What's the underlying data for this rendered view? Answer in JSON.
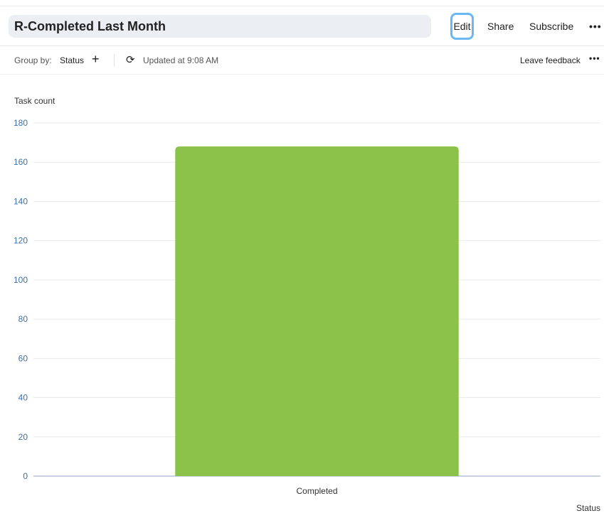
{
  "header": {
    "title": "R-Completed Last Month",
    "edit": "Edit",
    "share": "Share",
    "subscribe": "Subscribe",
    "more": "•••"
  },
  "toolbar": {
    "group_by_label": "Group by:",
    "group_by_value": "Status",
    "add": "+",
    "updated": "Updated at 9:08 AM",
    "feedback": "Leave feedback",
    "more": "•••"
  },
  "chart_data": {
    "type": "bar",
    "categories": [
      "Completed"
    ],
    "values": [
      168
    ],
    "ylabel": "Task count",
    "xlabel": "Status",
    "ylim": [
      0,
      180
    ],
    "yticks": [
      0,
      20,
      40,
      60,
      80,
      100,
      120,
      140,
      160,
      180
    ],
    "grid": true,
    "bar_color": "#8bc34a"
  }
}
